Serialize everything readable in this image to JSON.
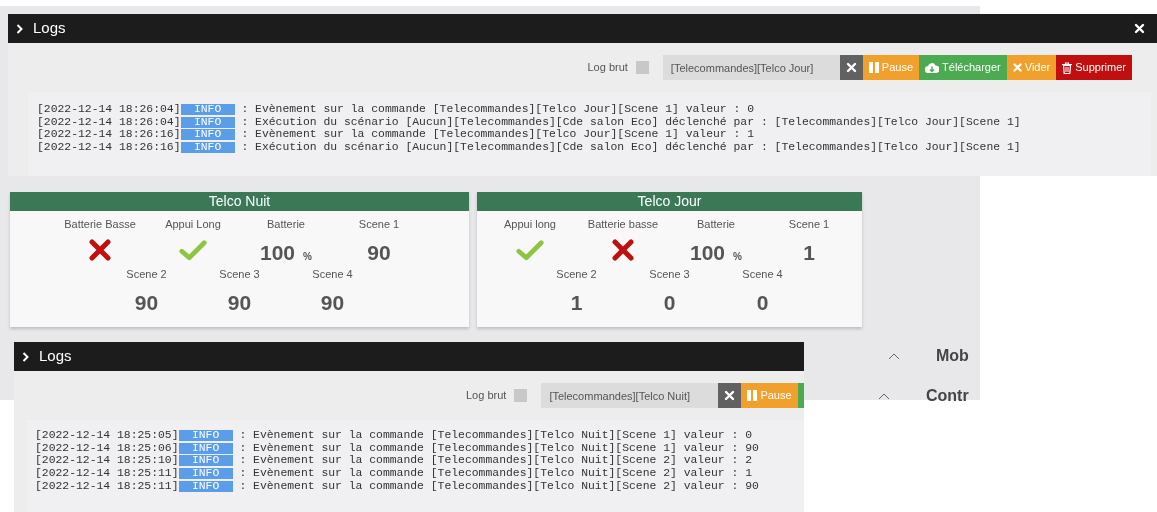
{
  "backdrop": {
    "items": [
      {
        "label": "Mob",
        "expanded": true
      },
      {
        "label": "Contr",
        "expanded": true
      }
    ]
  },
  "log_windows": [
    {
      "title": "Logs",
      "closable": true,
      "log_brut": {
        "label": "Log brut",
        "checked": false
      },
      "filter": {
        "value": "[Telecommandes][Telco Jour]"
      },
      "buttons": [
        {
          "kind": "clear"
        },
        {
          "kind": "pause",
          "label": "Pause"
        },
        {
          "kind": "download",
          "label": "Télécharger"
        },
        {
          "kind": "empty",
          "label": "Vider"
        },
        {
          "kind": "delete",
          "label": "Supprimer"
        }
      ],
      "lines": [
        {
          "time": "[2022-12-14 18:26:04]",
          "level": "INFO",
          "message": " : Evènement sur la commande [Telecommandes][Telco Jour][Scene 1] valeur : 0"
        },
        {
          "time": "[2022-12-14 18:26:04]",
          "level": "INFO",
          "message": " : Exécution du scénario [Aucun][Telecommandes][Cde salon Eco] déclenché par : [Telecommandes][Telco Jour][Scene 1]"
        },
        {
          "time": "[2022-12-14 18:26:16]",
          "level": "INFO",
          "message": " : Evènement sur la commande [Telecommandes][Telco Jour][Scene 1] valeur : 1"
        },
        {
          "time": "[2022-12-14 18:26:16]",
          "level": "INFO",
          "message": " : Exécution du scénario [Aucun][Telecommandes][Cde salon Eco] déclenché par : [Telecommandes][Telco Jour][Scene 1]"
        }
      ]
    },
    {
      "title": "Logs",
      "log_brut": {
        "label": "Log brut",
        "checked": false
      },
      "filter": {
        "value": "[Telecommandes][Telco Nuit]"
      },
      "buttons": [
        {
          "kind": "clear"
        },
        {
          "kind": "pause",
          "label": "Pause"
        },
        {
          "kind": "download"
        }
      ],
      "lines": [
        {
          "time": "[2022-12-14 18:25:05]",
          "level": "INFO",
          "message": " : Evènement sur la commande [Telecommandes][Telco Nuit][Scene 1] valeur : 0"
        },
        {
          "time": "[2022-12-14 18:25:06]",
          "level": "INFO",
          "message": " : Evènement sur la commande [Telecommandes][Telco Nuit][Scene 1] valeur : 90"
        },
        {
          "time": "[2022-12-14 18:25:10]",
          "level": "INFO",
          "message": " : Evènement sur la commande [Telecommandes][Telco Nuit][Scene 2] valeur : 2"
        },
        {
          "time": "[2022-12-14 18:25:11]",
          "level": "INFO",
          "message": " : Evènement sur la commande [Telecommandes][Telco Nuit][Scene 2] valeur : 1"
        },
        {
          "time": "[2022-12-14 18:25:11]",
          "level": "INFO",
          "message": " : Evènement sur la commande [Telecommandes][Telco Nuit][Scene 2] valeur : 90"
        }
      ]
    }
  ],
  "widgets": [
    {
      "title": "Telco Nuit",
      "items": [
        {
          "label": "Batterie Basse",
          "kind": "state",
          "on": false
        },
        {
          "label": "Appui Long",
          "kind": "state",
          "on": true
        },
        {
          "label": "Batterie",
          "kind": "number",
          "value": "100",
          "unit": "%"
        },
        {
          "label": "Scene 1",
          "kind": "number",
          "value": "90"
        },
        {
          "label": "Scene 2",
          "kind": "number",
          "value": "90"
        },
        {
          "label": "Scene 3",
          "kind": "number",
          "value": "90"
        },
        {
          "label": "Scene 4",
          "kind": "number",
          "value": "90"
        }
      ]
    },
    {
      "title": "Telco Jour",
      "items": [
        {
          "label": "Appui long",
          "kind": "state",
          "on": true
        },
        {
          "label": "Batterie basse",
          "kind": "state",
          "on": false
        },
        {
          "label": "Batterie",
          "kind": "number",
          "value": "100",
          "unit": "%"
        },
        {
          "label": "Scene 1",
          "kind": "number",
          "value": "1"
        },
        {
          "label": "Scene 2",
          "kind": "number",
          "value": "1"
        },
        {
          "label": "Scene 3",
          "kind": "number",
          "value": "0"
        },
        {
          "label": "Scene 4",
          "kind": "number",
          "value": "0"
        }
      ]
    }
  ]
}
